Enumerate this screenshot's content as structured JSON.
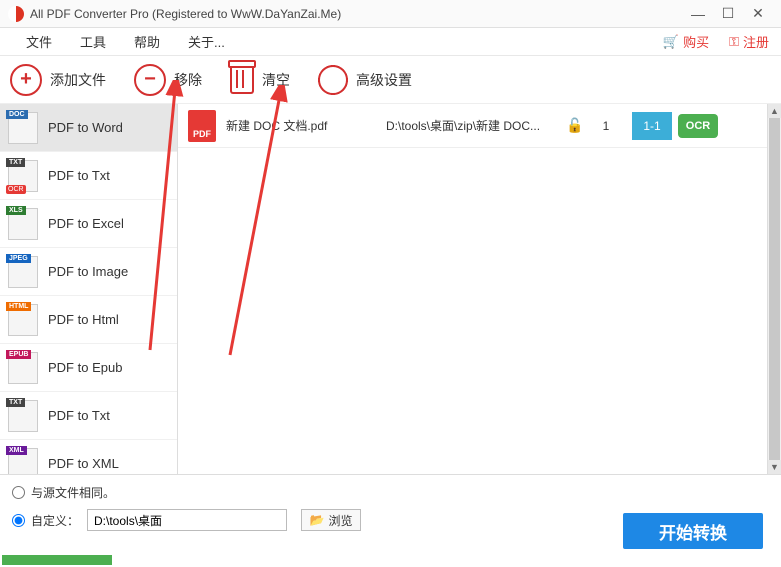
{
  "titlebar": {
    "title": "All PDF Converter Pro (Registered to WwW.DaYanZai.Me)"
  },
  "menubar": {
    "file": "文件",
    "tools": "工具",
    "help": "帮助",
    "about": "关于...",
    "buy": "购买",
    "register": "注册"
  },
  "toolbar": {
    "add": "添加文件",
    "remove": "移除",
    "clear": "清空",
    "settings": "高级设置"
  },
  "sidebar": {
    "items": [
      {
        "tag": "DOC",
        "tagColor": "#2b6cb0",
        "label": "PDF to Word"
      },
      {
        "tag": "TXT",
        "tagColor": "#444",
        "label": "PDF to Txt",
        "ocr": true
      },
      {
        "tag": "XLS",
        "tagColor": "#2e7d32",
        "label": "PDF to Excel"
      },
      {
        "tag": "JPEG",
        "tagColor": "#1565c0",
        "label": "PDF to Image"
      },
      {
        "tag": "HTML",
        "tagColor": "#ef6c00",
        "label": "PDF to Html"
      },
      {
        "tag": "EPUB",
        "tagColor": "#c2185b",
        "label": "PDF to Epub"
      },
      {
        "tag": "TXT",
        "tagColor": "#444",
        "label": "PDF to Txt"
      },
      {
        "tag": "XML",
        "tagColor": "#6a1b9a",
        "label": "PDF to XML"
      }
    ]
  },
  "files": [
    {
      "name": "新建 DOC 文档.pdf",
      "path": "D:\\tools\\桌面\\zip\\新建 DOC...",
      "pages": "1",
      "range": "1-1"
    }
  ],
  "output": {
    "sameAsSource": "与源文件相同。",
    "custom": "自定义：",
    "path": "D:\\tools\\桌面",
    "browse": "浏览"
  },
  "convert": "开始转换",
  "badges": {
    "pdf": "PDF",
    "ocr": "OCR"
  }
}
